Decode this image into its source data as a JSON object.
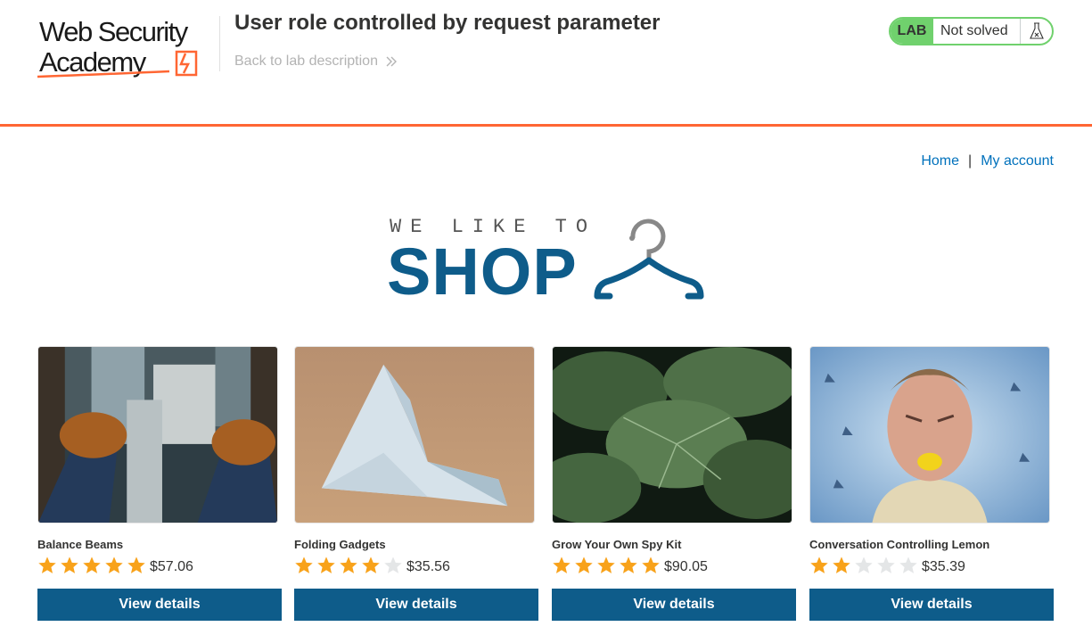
{
  "header": {
    "logo_line1": "Web Security",
    "logo_line2": "Academy",
    "lab_title": "User role controlled by request parameter",
    "back_link": "Back to lab description",
    "lab_badge": "LAB",
    "lab_status": "Not solved"
  },
  "nav": {
    "home": "Home",
    "separator": "|",
    "my_account": "My account"
  },
  "banner": {
    "top_text": "WE LIKE TO",
    "main_text": "SHOP"
  },
  "products": [
    {
      "name": "Balance Beams",
      "rating": 5,
      "price": "$57.06",
      "button": "View details"
    },
    {
      "name": "Folding Gadgets",
      "rating": 4,
      "price": "$35.56",
      "button": "View details"
    },
    {
      "name": "Grow Your Own Spy Kit",
      "rating": 5,
      "price": "$90.05",
      "button": "View details"
    },
    {
      "name": "Conversation Controlling Lemon",
      "rating": 2,
      "price": "$35.39",
      "button": "View details"
    }
  ],
  "colors": {
    "accent_orange": "#ff6633",
    "brand_blue": "#0e5c8a",
    "link_blue": "#0071bc",
    "status_green": "#70d16d",
    "star_filled": "#f8a21a",
    "star_empty": "#e4e6e7"
  },
  "icons": {
    "back": "double-chevron-right-icon",
    "lab_status": "flask-icon",
    "banner": "hanger-icon",
    "rating": "star-icon"
  }
}
